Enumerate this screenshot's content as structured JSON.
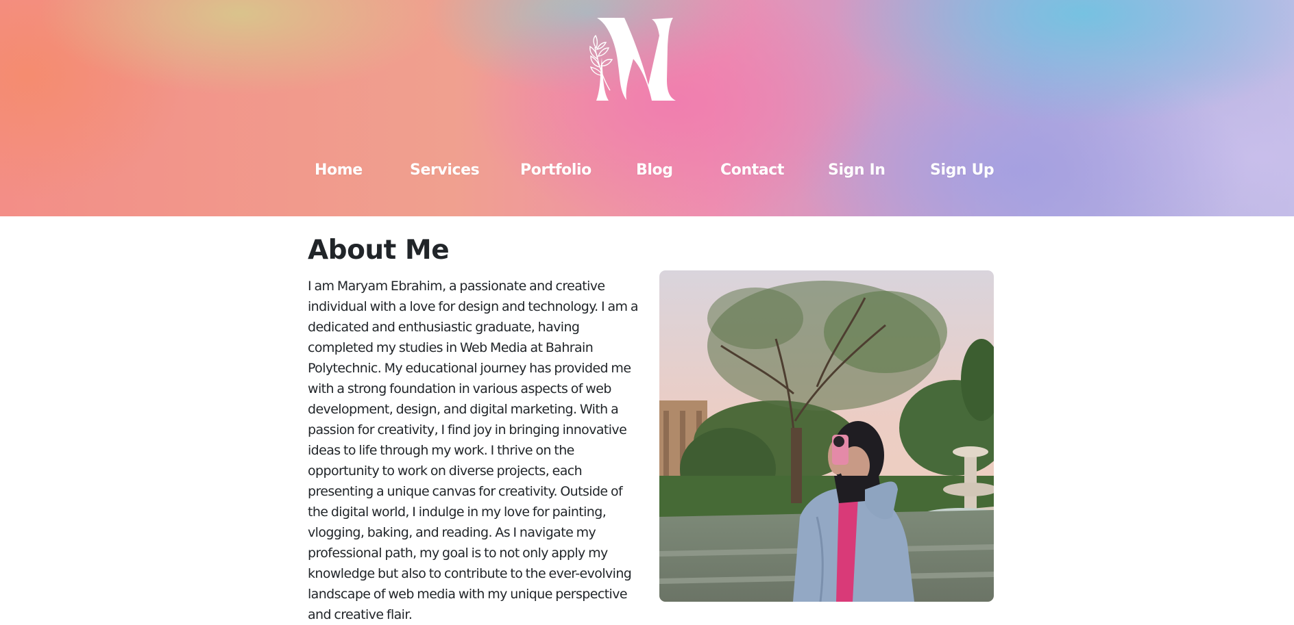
{
  "nav": {
    "items": [
      "Home",
      "Services",
      "Portfolio",
      "Blog",
      "Contact",
      "Sign In",
      "Sign Up"
    ]
  },
  "about": {
    "title": "About Me",
    "text": "I am Maryam Ebrahim, a passionate and creative individual with a love for design and technology. I am a dedicated and enthusiastic graduate, having completed my studies in Web Media at Bahrain Polytechnic. My educational journey has provided me with a strong foundation in various aspects of web development, design, and digital marketing. With a passion for creativity, I find joy in bringing innovative ideas to life through my work. I thrive on the opportunity to work on diverse projects, each presenting a unique canvas for creativity. Outside of the digital world, I indulge in my love for painting, vlogging, baking, and reading. As I navigate my professional path, my goal is to not only apply my knowledge but also to contribute to the ever-evolving landscape of web media with my unique perspective and creative flair."
  },
  "icons": {
    "logo": "monogram-m-logo",
    "photo": "profile-photo"
  },
  "colors": {
    "text": "#212529",
    "nav_text": "#ffffff",
    "page_background": "#ffffff"
  }
}
